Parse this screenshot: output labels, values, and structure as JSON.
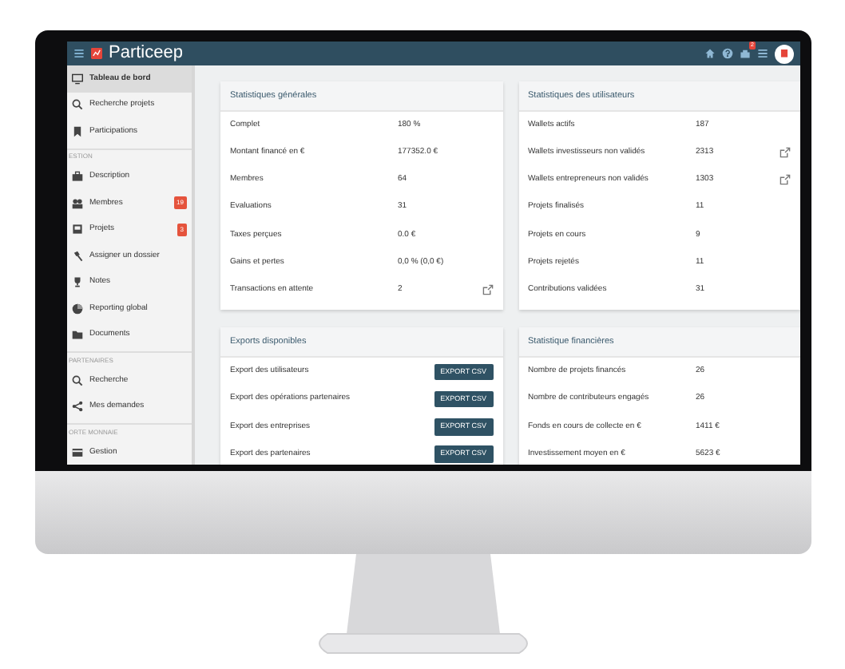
{
  "topbar": {
    "brand": "Particeep",
    "notification_badge": "2"
  },
  "sidebar": {
    "items": [
      {
        "kind": "item",
        "label": "Tableau de bord",
        "selected": true
      },
      {
        "kind": "item",
        "label": "Recherche projets",
        "selected": false
      },
      {
        "kind": "item",
        "label": "Participations",
        "selected": false
      },
      {
        "kind": "section",
        "label": "ESTION"
      },
      {
        "kind": "item",
        "label": "Description",
        "selected": false
      },
      {
        "kind": "item",
        "label": "Membres",
        "selected": false,
        "badge": "19"
      },
      {
        "kind": "item",
        "label": "Projets",
        "selected": false,
        "badge": "3"
      },
      {
        "kind": "item",
        "label": "Assigner un dossier",
        "selected": false
      },
      {
        "kind": "item",
        "label": "Notes",
        "selected": false
      },
      {
        "kind": "item",
        "label": "Reporting global",
        "selected": false
      },
      {
        "kind": "item",
        "label": "Documents",
        "selected": false
      },
      {
        "kind": "section",
        "label": "PARTENAIRES"
      },
      {
        "kind": "item",
        "label": "Recherche",
        "selected": false
      },
      {
        "kind": "item",
        "label": "Mes demandes",
        "selected": false
      },
      {
        "kind": "section",
        "label": "ORTE MONNAIE"
      },
      {
        "kind": "item",
        "label": "Gestion",
        "selected": false
      }
    ]
  },
  "columns": [
    [
      {
        "title": "Statistiques générales",
        "rows": [
          {
            "kind": "stat",
            "label": "Complet",
            "value": "180 %"
          },
          {
            "kind": "stat",
            "label": "Montant financé en €",
            "value": "177352.0 €"
          },
          {
            "kind": "stat",
            "label": "Membres",
            "value": "64"
          },
          {
            "kind": "stat",
            "label": "Evaluations",
            "value": "31"
          },
          {
            "kind": "stat",
            "label": "Taxes perçues",
            "value": "0.0 €"
          },
          {
            "kind": "stat",
            "label": "Gains et pertes",
            "value": "0,0 % (0,0 €)"
          },
          {
            "kind": "stat",
            "label": "Transactions en attente",
            "value": "2",
            "edit": true
          }
        ]
      },
      {
        "title": "Exports disponibles",
        "rows": [
          {
            "kind": "export",
            "label": "Export des utilisateurs",
            "button": "EXPORT CSV"
          },
          {
            "kind": "export",
            "label": "Export des opérations partenaires",
            "button": "EXPORT CSV"
          },
          {
            "kind": "export",
            "label": "Export des entreprises",
            "button": "EXPORT CSV"
          },
          {
            "kind": "export",
            "label": "Export des partenaires",
            "button": "EXPORT CSV"
          }
        ]
      }
    ],
    [
      {
        "title": "Statistiques des utilisateurs",
        "rows": [
          {
            "kind": "stat",
            "label": "Wallets actifs",
            "value": "187"
          },
          {
            "kind": "stat",
            "label": "Wallets investisseurs non validés",
            "value": "2313",
            "edit": true
          },
          {
            "kind": "stat",
            "label": "Wallets entrepreneurs non validés",
            "value": "1303",
            "edit": true
          },
          {
            "kind": "stat",
            "label": "Projets finalisés",
            "value": "11"
          },
          {
            "kind": "stat",
            "label": "Projets en cours",
            "value": "9"
          },
          {
            "kind": "stat",
            "label": "Projets rejetés",
            "value": "11"
          },
          {
            "kind": "stat",
            "label": "Contributions validées",
            "value": "31"
          }
        ]
      },
      {
        "title": "Statistique financières",
        "rows": [
          {
            "kind": "stat",
            "label": "Nombre de projets financés",
            "value": "26"
          },
          {
            "kind": "stat",
            "label": "Nombre de contributeurs engagés",
            "value": "26"
          },
          {
            "kind": "stat",
            "label": "Fonds en cours de collecte en €",
            "value": "1411 €"
          },
          {
            "kind": "stat",
            "label": "Investissement moyen en €",
            "value": "5623 €"
          }
        ]
      }
    ]
  ]
}
